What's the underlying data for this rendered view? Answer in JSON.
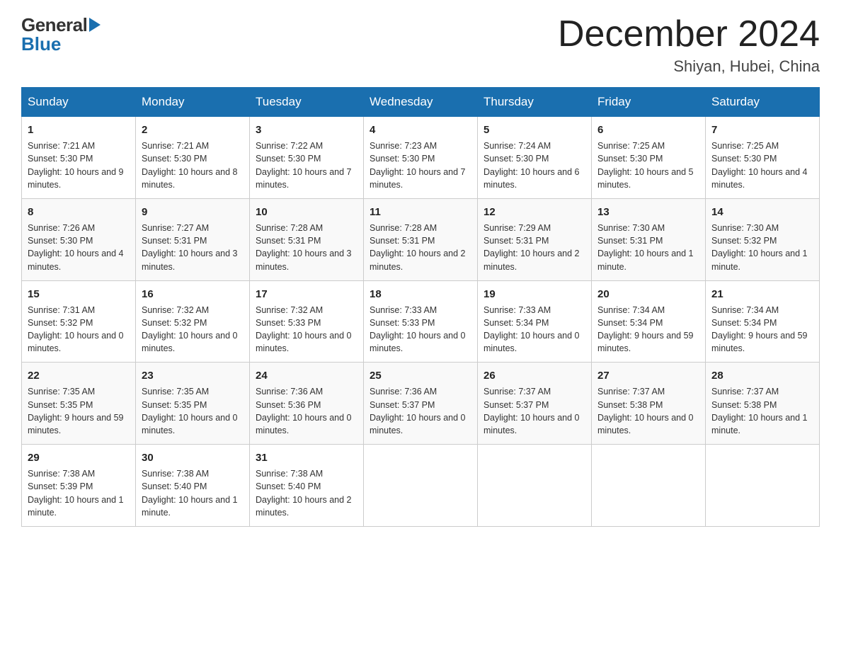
{
  "header": {
    "logo_general": "General",
    "logo_blue": "Blue",
    "month_title": "December 2024",
    "location": "Shiyan, Hubei, China"
  },
  "days_of_week": [
    "Sunday",
    "Monday",
    "Tuesday",
    "Wednesday",
    "Thursday",
    "Friday",
    "Saturday"
  ],
  "weeks": [
    [
      {
        "day": "1",
        "sunrise": "7:21 AM",
        "sunset": "5:30 PM",
        "daylight": "10 hours and 9 minutes."
      },
      {
        "day": "2",
        "sunrise": "7:21 AM",
        "sunset": "5:30 PM",
        "daylight": "10 hours and 8 minutes."
      },
      {
        "day": "3",
        "sunrise": "7:22 AM",
        "sunset": "5:30 PM",
        "daylight": "10 hours and 7 minutes."
      },
      {
        "day": "4",
        "sunrise": "7:23 AM",
        "sunset": "5:30 PM",
        "daylight": "10 hours and 7 minutes."
      },
      {
        "day": "5",
        "sunrise": "7:24 AM",
        "sunset": "5:30 PM",
        "daylight": "10 hours and 6 minutes."
      },
      {
        "day": "6",
        "sunrise": "7:25 AM",
        "sunset": "5:30 PM",
        "daylight": "10 hours and 5 minutes."
      },
      {
        "day": "7",
        "sunrise": "7:25 AM",
        "sunset": "5:30 PM",
        "daylight": "10 hours and 4 minutes."
      }
    ],
    [
      {
        "day": "8",
        "sunrise": "7:26 AM",
        "sunset": "5:30 PM",
        "daylight": "10 hours and 4 minutes."
      },
      {
        "day": "9",
        "sunrise": "7:27 AM",
        "sunset": "5:31 PM",
        "daylight": "10 hours and 3 minutes."
      },
      {
        "day": "10",
        "sunrise": "7:28 AM",
        "sunset": "5:31 PM",
        "daylight": "10 hours and 3 minutes."
      },
      {
        "day": "11",
        "sunrise": "7:28 AM",
        "sunset": "5:31 PM",
        "daylight": "10 hours and 2 minutes."
      },
      {
        "day": "12",
        "sunrise": "7:29 AM",
        "sunset": "5:31 PM",
        "daylight": "10 hours and 2 minutes."
      },
      {
        "day": "13",
        "sunrise": "7:30 AM",
        "sunset": "5:31 PM",
        "daylight": "10 hours and 1 minute."
      },
      {
        "day": "14",
        "sunrise": "7:30 AM",
        "sunset": "5:32 PM",
        "daylight": "10 hours and 1 minute."
      }
    ],
    [
      {
        "day": "15",
        "sunrise": "7:31 AM",
        "sunset": "5:32 PM",
        "daylight": "10 hours and 0 minutes."
      },
      {
        "day": "16",
        "sunrise": "7:32 AM",
        "sunset": "5:32 PM",
        "daylight": "10 hours and 0 minutes."
      },
      {
        "day": "17",
        "sunrise": "7:32 AM",
        "sunset": "5:33 PM",
        "daylight": "10 hours and 0 minutes."
      },
      {
        "day": "18",
        "sunrise": "7:33 AM",
        "sunset": "5:33 PM",
        "daylight": "10 hours and 0 minutes."
      },
      {
        "day": "19",
        "sunrise": "7:33 AM",
        "sunset": "5:34 PM",
        "daylight": "10 hours and 0 minutes."
      },
      {
        "day": "20",
        "sunrise": "7:34 AM",
        "sunset": "5:34 PM",
        "daylight": "9 hours and 59 minutes."
      },
      {
        "day": "21",
        "sunrise": "7:34 AM",
        "sunset": "5:34 PM",
        "daylight": "9 hours and 59 minutes."
      }
    ],
    [
      {
        "day": "22",
        "sunrise": "7:35 AM",
        "sunset": "5:35 PM",
        "daylight": "9 hours and 59 minutes."
      },
      {
        "day": "23",
        "sunrise": "7:35 AM",
        "sunset": "5:35 PM",
        "daylight": "10 hours and 0 minutes."
      },
      {
        "day": "24",
        "sunrise": "7:36 AM",
        "sunset": "5:36 PM",
        "daylight": "10 hours and 0 minutes."
      },
      {
        "day": "25",
        "sunrise": "7:36 AM",
        "sunset": "5:37 PM",
        "daylight": "10 hours and 0 minutes."
      },
      {
        "day": "26",
        "sunrise": "7:37 AM",
        "sunset": "5:37 PM",
        "daylight": "10 hours and 0 minutes."
      },
      {
        "day": "27",
        "sunrise": "7:37 AM",
        "sunset": "5:38 PM",
        "daylight": "10 hours and 0 minutes."
      },
      {
        "day": "28",
        "sunrise": "7:37 AM",
        "sunset": "5:38 PM",
        "daylight": "10 hours and 1 minute."
      }
    ],
    [
      {
        "day": "29",
        "sunrise": "7:38 AM",
        "sunset": "5:39 PM",
        "daylight": "10 hours and 1 minute."
      },
      {
        "day": "30",
        "sunrise": "7:38 AM",
        "sunset": "5:40 PM",
        "daylight": "10 hours and 1 minute."
      },
      {
        "day": "31",
        "sunrise": "7:38 AM",
        "sunset": "5:40 PM",
        "daylight": "10 hours and 2 minutes."
      },
      null,
      null,
      null,
      null
    ]
  ],
  "labels": {
    "sunrise_prefix": "Sunrise: ",
    "sunset_prefix": "Sunset: ",
    "daylight_prefix": "Daylight: "
  }
}
